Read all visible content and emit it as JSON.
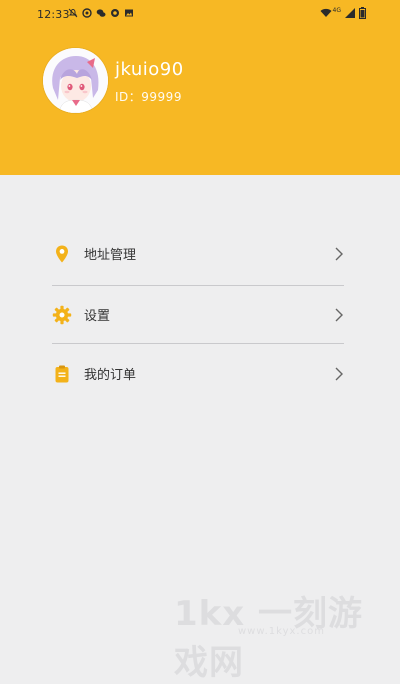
{
  "status_bar": {
    "time": "12:33",
    "network": "4G"
  },
  "profile": {
    "username": "jkuio90",
    "user_id": "ID：99999"
  },
  "menu": {
    "items": [
      {
        "label": "地址管理",
        "icon": "location-pin-icon"
      },
      {
        "label": "设置",
        "icon": "gear-icon"
      },
      {
        "label": "我的订单",
        "icon": "clipboard-icon"
      }
    ]
  },
  "colors": {
    "header": "#f7b824",
    "accent_icon": "#f3b21a",
    "background": "#eeeeef"
  },
  "watermark": {
    "main": "1kx 一刻游戏网",
    "sub": "www.1kyx.com"
  }
}
